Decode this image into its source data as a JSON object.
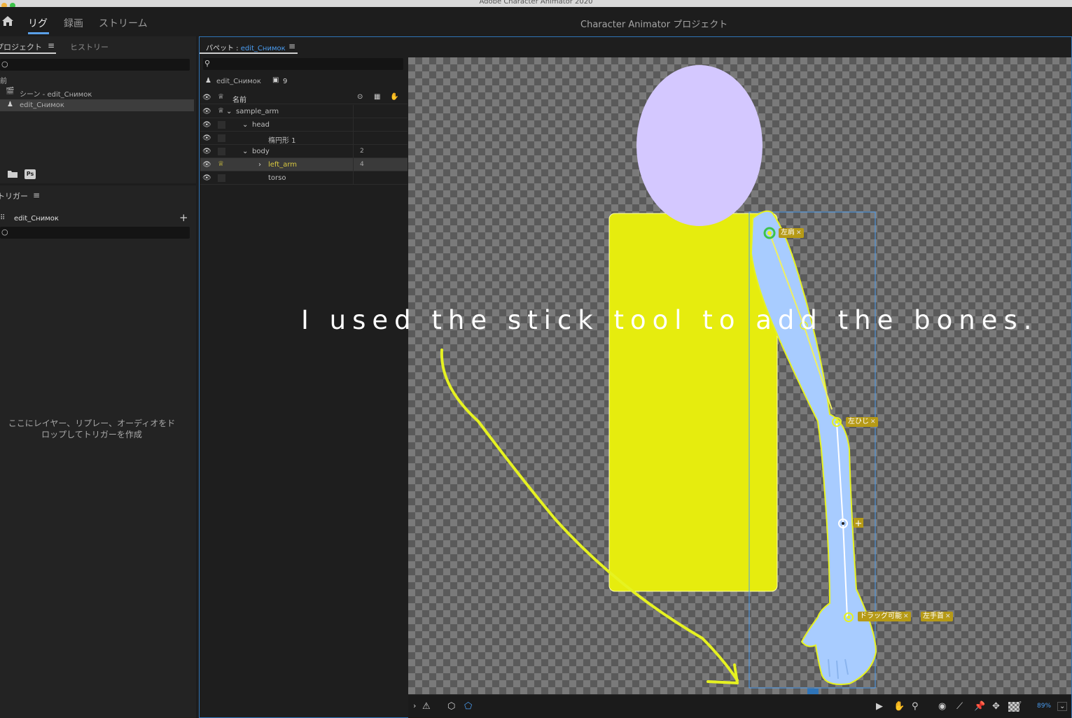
{
  "app": {
    "window_title": "Adobe Character Animator 2020"
  },
  "workspace": {
    "tabs": [
      {
        "label": "リグ",
        "active": true
      },
      {
        "label": "録画",
        "active": false
      },
      {
        "label": "ストリーム",
        "active": false
      }
    ],
    "project_title": "Character Animator プロジェクト"
  },
  "project_panel": {
    "tab_project": "プロジェクト",
    "tab_history": "ヒストリー",
    "column_name": "前",
    "items": [
      {
        "label": "シーン - edit_Снимок",
        "type": "scene"
      },
      {
        "label": "edit_Снимок",
        "type": "puppet",
        "selected": true
      }
    ],
    "ps_badge": "Ps"
  },
  "trigger_panel": {
    "tab": "トリガー",
    "puppet_name": "edit_Снимок",
    "add_label": "+",
    "empty_message": "ここにレイヤー、リプレー、オーディオをドロップしてトリガーを作成"
  },
  "puppet_panel": {
    "tab_prefix": "パペット : ",
    "tab_puppet": "edit_Снимок",
    "puppet_name": "edit_Снимок",
    "handle_count": "9",
    "column_name": "名前",
    "layers": [
      {
        "name": "sample_arm",
        "indent": 1,
        "expanded": true,
        "num": "",
        "selected": false,
        "crown": true
      },
      {
        "name": "head",
        "indent": 2,
        "expanded": true,
        "num": "",
        "selected": false,
        "crown": false
      },
      {
        "name": "楕円形 1",
        "indent": 3,
        "expanded": null,
        "num": "",
        "selected": false,
        "crown": false
      },
      {
        "name": "body",
        "indent": 2,
        "expanded": true,
        "num": "2",
        "selected": false,
        "crown": false
      },
      {
        "name": "left_arm",
        "indent": 3,
        "expanded": false,
        "num": "4",
        "selected": true,
        "crown": true
      },
      {
        "name": "torso",
        "indent": 3,
        "expanded": null,
        "num": "",
        "selected": false,
        "crown": false
      }
    ],
    "zoom": "89%"
  },
  "canvas": {
    "caption": "I used the stick tool to add the bones.",
    "tags": {
      "shoulder": "左肩",
      "elbow": "左ひじ",
      "draggable": "ドラッグ可能",
      "wrist": "左手首"
    },
    "colors": {
      "head": "#d4c8ff",
      "torso": "#e6ec0e",
      "arm": "#a8ccff",
      "annotation": "#e6f221",
      "tag": "#b69a16",
      "selection": "#4a9cf0"
    }
  }
}
